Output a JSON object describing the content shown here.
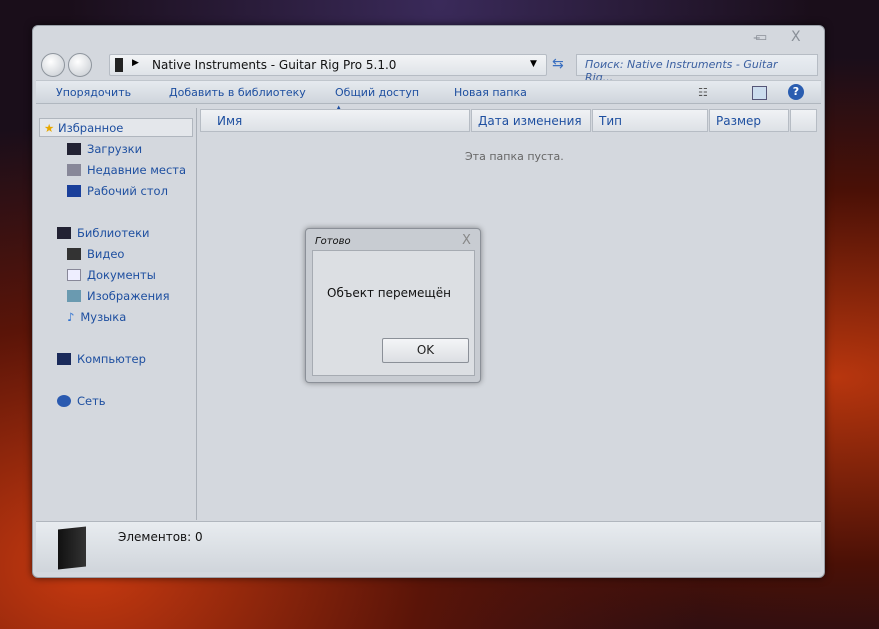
{
  "window": {
    "controls": [
      "–",
      "▭",
      "X"
    ]
  },
  "address": {
    "path": "Native Instruments - Guitar Rig Pro 5.1.0",
    "search_placeholder": "Поиск: Native Instruments - Guitar Rig..."
  },
  "toolbar": {
    "organize": "Упорядочить",
    "add_library": "Добавить в библиотеку",
    "share": "Общий доступ",
    "new_folder": "Новая папка"
  },
  "sidebar": {
    "favorites": "Избранное",
    "downloads": "Загрузки",
    "recent": "Недавние места",
    "desktop": "Рабочий стол",
    "libraries": "Библиотеки",
    "video": "Видео",
    "documents": "Документы",
    "images": "Изображения",
    "music": "Музыка",
    "computer": "Компьютер",
    "network": "Сеть"
  },
  "columns": {
    "name": "Имя",
    "date": "Дата изменения",
    "type": "Тип",
    "size": "Размер"
  },
  "content": {
    "empty": "Эта папка пуста."
  },
  "status": {
    "items": "Элементов: 0"
  },
  "dialog": {
    "title": "Готово",
    "message": "Объект перемещён",
    "ok": "OK",
    "close": "X"
  }
}
